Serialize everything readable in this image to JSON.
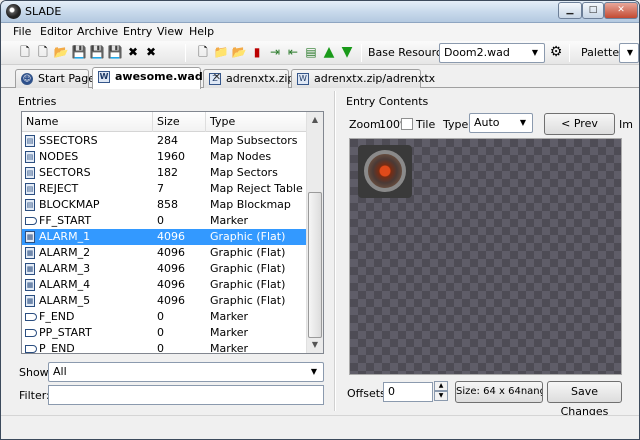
{
  "window": {
    "title": "SLADE"
  },
  "menu": [
    "File",
    "Editor",
    "Archive",
    "Entry",
    "View",
    "Help"
  ],
  "toolbar": {
    "base_resource_label": "Base Resource:",
    "base_resource_value": "Doom2.wad",
    "palette_label": "Palette:"
  },
  "tabs": [
    {
      "label": "Start Page",
      "icon": "slade-icon"
    },
    {
      "label": "awesome.wad",
      "icon": "wad-icon"
    },
    {
      "label": "adrenxtx.zip",
      "icon": "zip-icon"
    },
    {
      "label": "adrenxtx.zip/adrenxtx",
      "icon": "folder-icon"
    }
  ],
  "entries": {
    "title": "Entries",
    "columns": [
      "Name",
      "Size",
      "Type"
    ],
    "rows": [
      {
        "name": "SSECTORS",
        "size": "284",
        "type": "Map Subsectors",
        "icon": "data"
      },
      {
        "name": "NODES",
        "size": "1960",
        "type": "Map Nodes",
        "icon": "data"
      },
      {
        "name": "SECTORS",
        "size": "182",
        "type": "Map Sectors",
        "icon": "data"
      },
      {
        "name": "REJECT",
        "size": "7",
        "type": "Map Reject Table",
        "icon": "data"
      },
      {
        "name": "BLOCKMAP",
        "size": "858",
        "type": "Map Blockmap",
        "icon": "data"
      },
      {
        "name": "FF_START",
        "size": "0",
        "type": "Marker",
        "icon": "marker"
      },
      {
        "name": "ALARM_1",
        "size": "4096",
        "type": "Graphic (Flat)",
        "icon": "gfx",
        "selected": true
      },
      {
        "name": "ALARM_2",
        "size": "4096",
        "type": "Graphic (Flat)",
        "icon": "gfx"
      },
      {
        "name": "ALARM_3",
        "size": "4096",
        "type": "Graphic (Flat)",
        "icon": "gfx"
      },
      {
        "name": "ALARM_4",
        "size": "4096",
        "type": "Graphic (Flat)",
        "icon": "gfx"
      },
      {
        "name": "ALARM_5",
        "size": "4096",
        "type": "Graphic (Flat)",
        "icon": "gfx"
      },
      {
        "name": "F_END",
        "size": "0",
        "type": "Marker",
        "icon": "marker"
      },
      {
        "name": "PP_START",
        "size": "0",
        "type": "Marker",
        "icon": "marker"
      },
      {
        "name": "P_END",
        "size": "0",
        "type": "Marker",
        "icon": "marker"
      }
    ],
    "show_label": "Show:",
    "show_value": "All",
    "filter_label": "Filter:",
    "filter_value": ""
  },
  "contents": {
    "title": "Entry Contents",
    "zoom_label": "Zoom:",
    "zoom_value": "100%",
    "tile_label": "Tile",
    "type_label": "Type:",
    "type_value": "Auto",
    "prev_button": "< Prev",
    "cut_label": "Im",
    "offsets_label": "Offsets:",
    "offset_x": "0",
    "size_text": "Size: 64 x 64",
    "size_overlap": "nanges",
    "save_button": "Save Changes"
  }
}
